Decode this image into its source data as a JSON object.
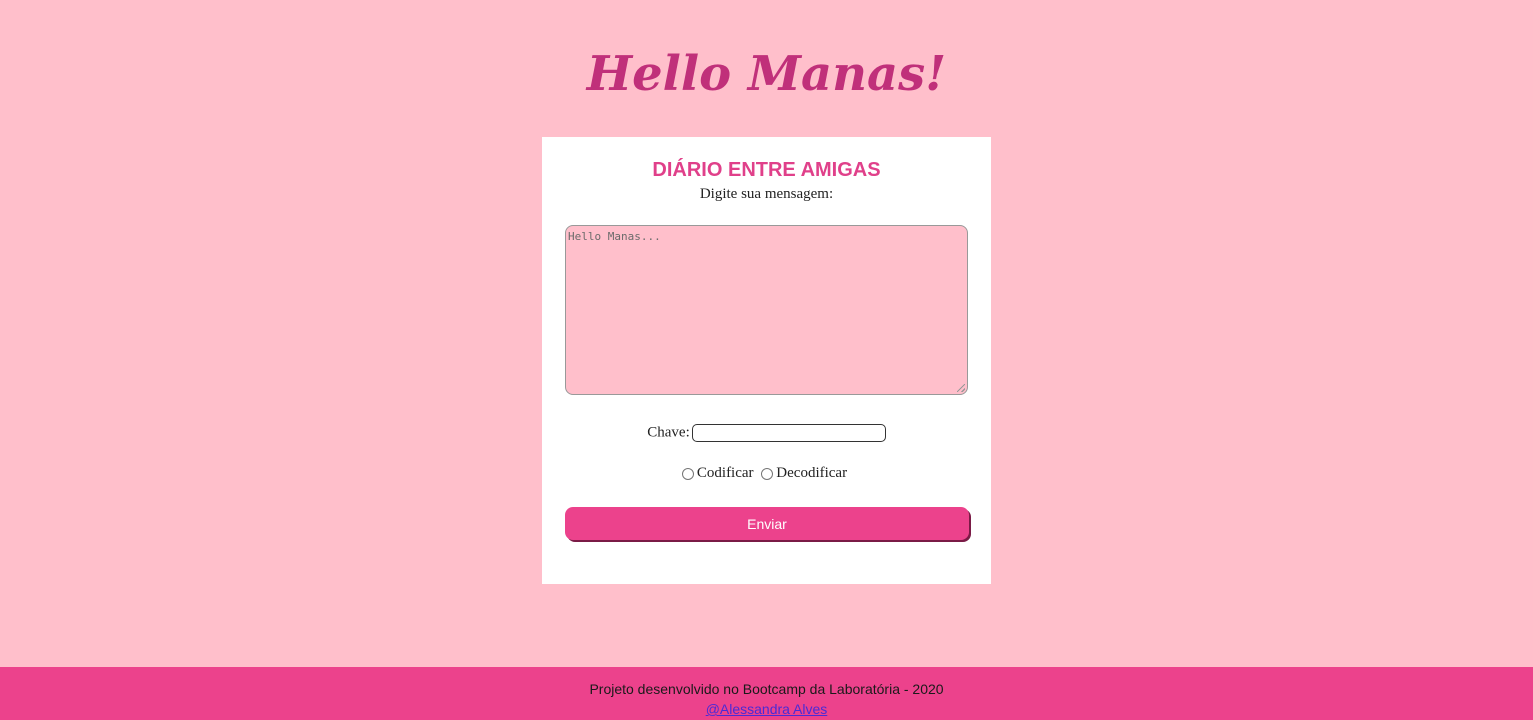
{
  "header": {
    "title": "Hello Manas!"
  },
  "card": {
    "heading": "DIÁRIO ENTRE AMIGAS",
    "subheading": "Digite sua mensagem:",
    "message": {
      "value": "",
      "placeholder": "Hello Manas..."
    },
    "key": {
      "label": "Chave:",
      "value": ""
    },
    "mode_options": [
      {
        "label": "Codificar",
        "selected": false
      },
      {
        "label": "Decodificar",
        "selected": false
      }
    ],
    "submit_label": "Enviar"
  },
  "footer": {
    "text": "Projeto desenvolvido no Bootcamp da Laboratória - 2020",
    "link_text": "@Alessandra Alves"
  },
  "colors": {
    "background": "#ffbfcb",
    "accent": "#ec428c",
    "title": "#c0307a",
    "heading": "#e0408a"
  }
}
